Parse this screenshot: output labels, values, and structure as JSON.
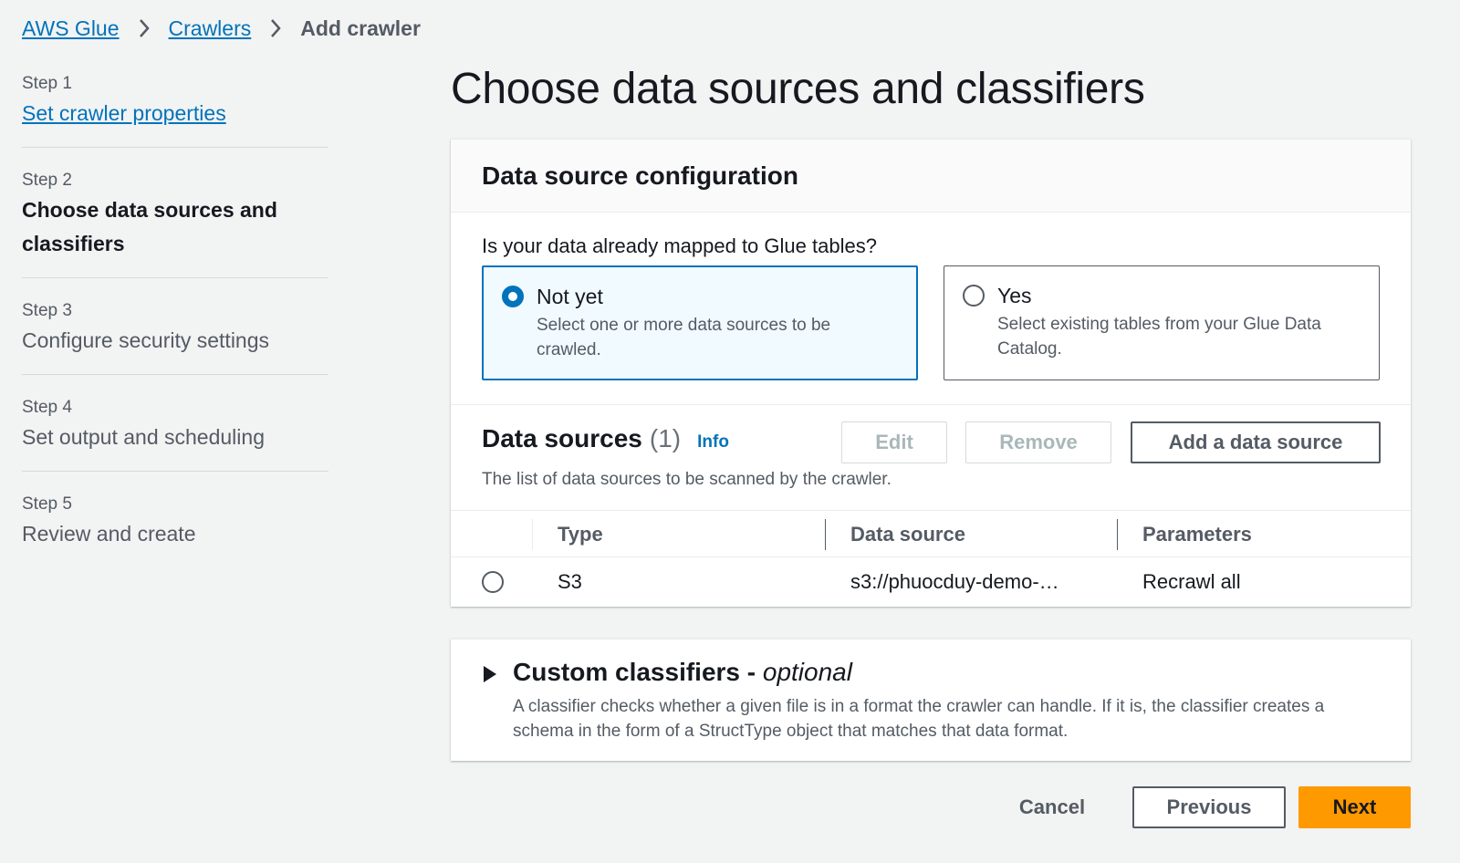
{
  "breadcrumb": {
    "items": [
      "AWS Glue",
      "Crawlers"
    ],
    "current": "Add crawler"
  },
  "steps": [
    {
      "number": "Step 1",
      "title": "Set crawler properties",
      "state": "link"
    },
    {
      "number": "Step 2",
      "title": "Choose data sources and classifiers",
      "state": "active"
    },
    {
      "number": "Step 3",
      "title": "Configure security settings",
      "state": "disabled"
    },
    {
      "number": "Step 4",
      "title": "Set output and scheduling",
      "state": "disabled"
    },
    {
      "number": "Step 5",
      "title": "Review and create",
      "state": "disabled"
    }
  ],
  "page": {
    "title": "Choose data sources and classifiers"
  },
  "data_source_config": {
    "heading": "Data source configuration",
    "question": "Is your data already mapped to Glue tables?",
    "options": [
      {
        "label": "Not yet",
        "description": "Select one or more data sources to be crawled.",
        "selected": true
      },
      {
        "label": "Yes",
        "description": "Select existing tables from your Glue Data Catalog.",
        "selected": false
      }
    ]
  },
  "data_sources": {
    "title": "Data sources",
    "count": "(1)",
    "info_label": "Info",
    "description": "The list of data sources to be scanned by the crawler.",
    "edit_label": "Edit",
    "remove_label": "Remove",
    "add_label": "Add a data source",
    "columns": [
      "Type",
      "Data source",
      "Parameters"
    ],
    "rows": [
      {
        "type": "S3",
        "source": "s3://phuocduy-demo-…",
        "parameters": "Recrawl all"
      }
    ]
  },
  "custom_classifiers": {
    "title": "Custom classifiers - ",
    "title_optional": "optional",
    "description": "A classifier checks whether a given file is in a format the crawler can handle. If it is, the classifier creates a schema in the form of a StructType object that matches that data format."
  },
  "footer": {
    "cancel_label": "Cancel",
    "previous_label": "Previous",
    "next_label": "Next"
  },
  "colors": {
    "link": "#0073bb",
    "primary_button": "#ff9900",
    "selected_tile_bg": "#f1faff",
    "page_bg": "#f2f3f3"
  },
  "icons": {
    "breadcrumb_separator": "chevron-right-icon",
    "expand_toggle": "caret-right-icon"
  }
}
